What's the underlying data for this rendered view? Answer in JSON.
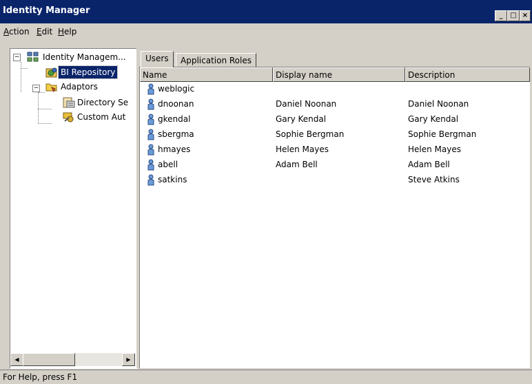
{
  "window": {
    "title": "Identity Manager",
    "minimize": "_",
    "maximize": "□",
    "close": "×"
  },
  "menu": [
    {
      "label_u": "A",
      "label_rest": "ction"
    },
    {
      "label_u": "E",
      "label_rest": "dit"
    },
    {
      "label_u": "H",
      "label_rest": "elp"
    }
  ],
  "tree": {
    "root": "Identity Managem...",
    "repository": "BI Repository",
    "adaptors": "Adaptors",
    "directory": "Directory Se",
    "custom": "Custom Aut"
  },
  "tabs": {
    "users": "Users",
    "roles": "Application Roles"
  },
  "columns": {
    "name": "Name",
    "display": "Display name",
    "description": "Description"
  },
  "users": [
    {
      "name": "weblogic",
      "display": "",
      "description": ""
    },
    {
      "name": "dnoonan",
      "display": "Daniel Noonan",
      "description": "Daniel Noonan"
    },
    {
      "name": "gkendal",
      "display": "Gary Kendal",
      "description": "Gary Kendal"
    },
    {
      "name": "sbergma",
      "display": "Sophie Bergman",
      "description": "Sophie Bergman"
    },
    {
      "name": "hmayes",
      "display": "Helen Mayes",
      "description": "Helen Mayes"
    },
    {
      "name": "abell",
      "display": "Adam Bell",
      "description": "Adam Bell"
    },
    {
      "name": "satkins",
      "display": "",
      "description": "Steve Atkins"
    }
  ],
  "status": "For Help, press F1",
  "colors": {
    "title_bar": "#0a246a",
    "selection": "#0a246a",
    "face": "#d4d0c8"
  }
}
